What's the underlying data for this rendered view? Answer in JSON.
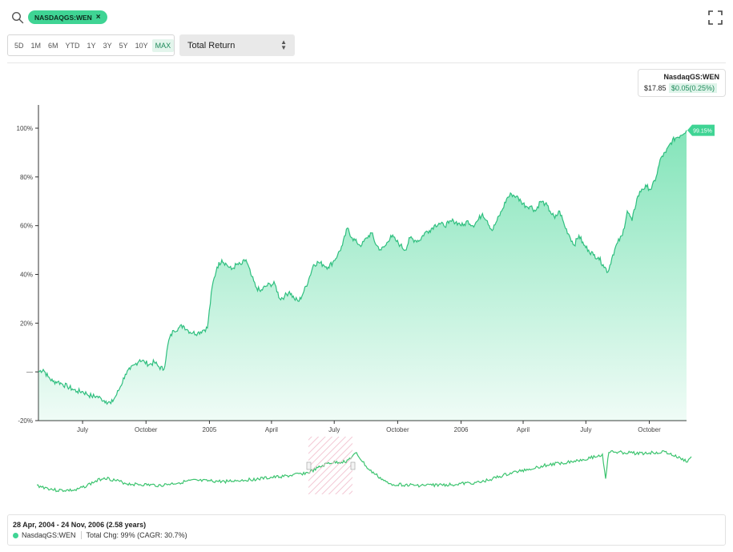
{
  "header": {
    "ticker_chip": "NASDAQGS:WEN",
    "chip_close": "×"
  },
  "range_buttons": [
    "5D",
    "1M",
    "6M",
    "YTD",
    "1Y",
    "3Y",
    "5Y",
    "10Y",
    "MAX"
  ],
  "active_range": "MAX",
  "return_select": {
    "value": "Total Return"
  },
  "price_box": {
    "ticker": "NasdaqGS:WEN",
    "price": "$17.85",
    "change": "$0.05(0.25%)"
  },
  "info": {
    "range_text": "28 Apr, 2004 - 24 Nov, 2006 (2.58 years)",
    "series_name": "NasdaqGS:WEN",
    "change_text": "Total Chg: 99% (CAGR: 30.7%)"
  },
  "colors": {
    "accent": "#3fd494",
    "line": "#2fbf7f",
    "fill_top": "#7de3b6"
  },
  "chart_data": {
    "type": "area",
    "x_start": "2004-04-28",
    "x_end": "2006-11-24",
    "ylim": [
      -20,
      105
    ],
    "yticks": [
      {
        "value": 100,
        "label": "100%"
      },
      {
        "value": 80,
        "label": "80%"
      },
      {
        "value": 60,
        "label": "60%"
      },
      {
        "value": 40,
        "label": "40%"
      },
      {
        "value": 20,
        "label": "20%"
      },
      {
        "value": 0,
        "label": "—"
      },
      {
        "value": -20,
        "label": "-20%"
      }
    ],
    "xticks": [
      {
        "date": "2004-07-01",
        "label": "July"
      },
      {
        "date": "2004-10-01",
        "label": "October"
      },
      {
        "date": "2005-01-01",
        "label": "2005"
      },
      {
        "date": "2005-04-01",
        "label": "April"
      },
      {
        "date": "2005-07-01",
        "label": "July"
      },
      {
        "date": "2005-10-01",
        "label": "October"
      },
      {
        "date": "2006-01-01",
        "label": "2006"
      },
      {
        "date": "2006-04-01",
        "label": "April"
      },
      {
        "date": "2006-07-01",
        "label": "July"
      },
      {
        "date": "2006-10-01",
        "label": "October"
      }
    ],
    "end_label": "99.15%",
    "series": [
      {
        "name": "NasdaqGS:WEN",
        "points": [
          [
            "2004-04-28",
            0
          ],
          [
            "2004-05-05",
            1
          ],
          [
            "2004-05-12",
            -2
          ],
          [
            "2004-05-19",
            -4
          ],
          [
            "2004-05-26",
            -4
          ],
          [
            "2004-06-02",
            -5
          ],
          [
            "2004-06-09",
            -6
          ],
          [
            "2004-06-16",
            -7
          ],
          [
            "2004-06-23",
            -8
          ],
          [
            "2004-06-30",
            -8
          ],
          [
            "2004-07-07",
            -9
          ],
          [
            "2004-07-14",
            -10
          ],
          [
            "2004-07-21",
            -10
          ],
          [
            "2004-07-28",
            -11
          ],
          [
            "2004-08-04",
            -12
          ],
          [
            "2004-08-11",
            -13
          ],
          [
            "2004-08-18",
            -10
          ],
          [
            "2004-08-25",
            -6
          ],
          [
            "2004-09-01",
            -1
          ],
          [
            "2004-09-08",
            1
          ],
          [
            "2004-09-15",
            3
          ],
          [
            "2004-09-22",
            5
          ],
          [
            "2004-09-29",
            4
          ],
          [
            "2004-10-06",
            3
          ],
          [
            "2004-10-13",
            4
          ],
          [
            "2004-10-20",
            2
          ],
          [
            "2004-10-27",
            1
          ],
          [
            "2004-11-03",
            13
          ],
          [
            "2004-11-10",
            17
          ],
          [
            "2004-11-17",
            18
          ],
          [
            "2004-11-24",
            19
          ],
          [
            "2004-12-01",
            17
          ],
          [
            "2004-12-08",
            16
          ],
          [
            "2004-12-15",
            16
          ],
          [
            "2004-12-22",
            17
          ],
          [
            "2004-12-29",
            18
          ],
          [
            "2005-01-05",
            35
          ],
          [
            "2005-01-12",
            43
          ],
          [
            "2005-01-19",
            46
          ],
          [
            "2005-01-26",
            44
          ],
          [
            "2005-02-02",
            42
          ],
          [
            "2005-02-09",
            44
          ],
          [
            "2005-02-16",
            44
          ],
          [
            "2005-02-23",
            46
          ],
          [
            "2005-03-02",
            40
          ],
          [
            "2005-03-09",
            35
          ],
          [
            "2005-03-16",
            33
          ],
          [
            "2005-03-23",
            35
          ],
          [
            "2005-03-30",
            36
          ],
          [
            "2005-04-06",
            36
          ],
          [
            "2005-04-13",
            30
          ],
          [
            "2005-04-20",
            31
          ],
          [
            "2005-04-27",
            33
          ],
          [
            "2005-05-04",
            30
          ],
          [
            "2005-05-11",
            29
          ],
          [
            "2005-05-18",
            33
          ],
          [
            "2005-05-25",
            38
          ],
          [
            "2005-06-01",
            44
          ],
          [
            "2005-06-08",
            45
          ],
          [
            "2005-06-15",
            44
          ],
          [
            "2005-06-22",
            43
          ],
          [
            "2005-06-29",
            45
          ],
          [
            "2005-07-06",
            48
          ],
          [
            "2005-07-13",
            52
          ],
          [
            "2005-07-20",
            59
          ],
          [
            "2005-07-27",
            55
          ],
          [
            "2005-08-03",
            53
          ],
          [
            "2005-08-10",
            52
          ],
          [
            "2005-08-17",
            55
          ],
          [
            "2005-08-24",
            57
          ],
          [
            "2005-08-31",
            52
          ],
          [
            "2005-09-07",
            50
          ],
          [
            "2005-09-14",
            52
          ],
          [
            "2005-09-21",
            56
          ],
          [
            "2005-09-28",
            54
          ],
          [
            "2005-10-05",
            52
          ],
          [
            "2005-10-12",
            50
          ],
          [
            "2005-10-19",
            55
          ],
          [
            "2005-10-26",
            54
          ],
          [
            "2005-11-02",
            54
          ],
          [
            "2005-11-09",
            57
          ],
          [
            "2005-11-16",
            58
          ],
          [
            "2005-11-23",
            60
          ],
          [
            "2005-11-30",
            61
          ],
          [
            "2005-12-07",
            60
          ],
          [
            "2005-12-14",
            61
          ],
          [
            "2005-12-21",
            62
          ],
          [
            "2005-12-28",
            61
          ],
          [
            "2006-01-04",
            60
          ],
          [
            "2006-01-11",
            62
          ],
          [
            "2006-01-18",
            60
          ],
          [
            "2006-01-25",
            62
          ],
          [
            "2006-02-01",
            65
          ],
          [
            "2006-02-08",
            62
          ],
          [
            "2006-02-15",
            58
          ],
          [
            "2006-02-22",
            62
          ],
          [
            "2006-03-01",
            66
          ],
          [
            "2006-03-08",
            71
          ],
          [
            "2006-03-15",
            73
          ],
          [
            "2006-03-22",
            72
          ],
          [
            "2006-03-29",
            70
          ],
          [
            "2006-04-05",
            68
          ],
          [
            "2006-04-12",
            68
          ],
          [
            "2006-04-19",
            66
          ],
          [
            "2006-04-26",
            70
          ],
          [
            "2006-05-03",
            69
          ],
          [
            "2006-05-10",
            66
          ],
          [
            "2006-05-17",
            63
          ],
          [
            "2006-05-24",
            66
          ],
          [
            "2006-05-31",
            60
          ],
          [
            "2006-06-07",
            56
          ],
          [
            "2006-06-14",
            52
          ],
          [
            "2006-06-21",
            56
          ],
          [
            "2006-06-28",
            52
          ],
          [
            "2006-07-05",
            50
          ],
          [
            "2006-07-12",
            48
          ],
          [
            "2006-07-19",
            47
          ],
          [
            "2006-07-26",
            44
          ],
          [
            "2006-08-02",
            41
          ],
          [
            "2006-08-09",
            48
          ],
          [
            "2006-08-16",
            53
          ],
          [
            "2006-08-23",
            56
          ],
          [
            "2006-08-30",
            66
          ],
          [
            "2006-09-06",
            62
          ],
          [
            "2006-09-13",
            71
          ],
          [
            "2006-09-20",
            75
          ],
          [
            "2006-09-27",
            76
          ],
          [
            "2006-10-04",
            75
          ],
          [
            "2006-10-11",
            80
          ],
          [
            "2006-10-18",
            88
          ],
          [
            "2006-10-25",
            90
          ],
          [
            "2006-11-01",
            94
          ],
          [
            "2006-11-08",
            96
          ],
          [
            "2006-11-15",
            97
          ],
          [
            "2006-11-24",
            99.15
          ]
        ]
      }
    ]
  }
}
